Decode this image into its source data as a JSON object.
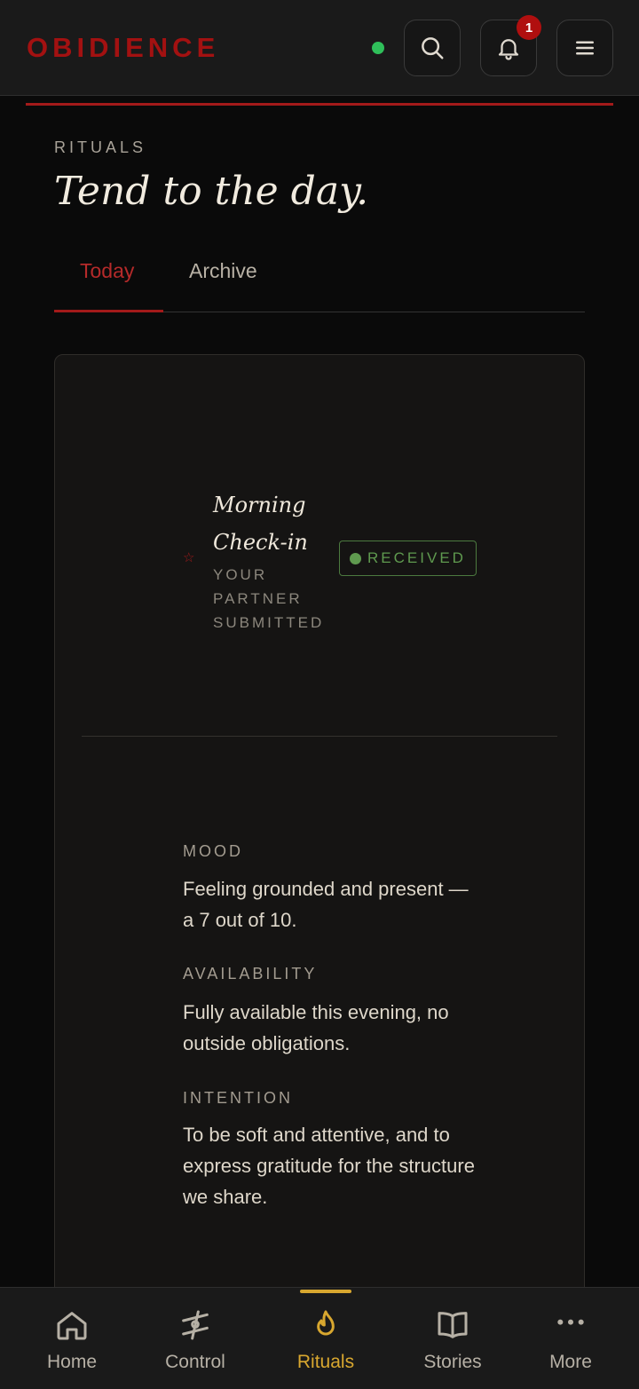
{
  "header": {
    "brand": "OBIDIENCE",
    "notification_count": "1",
    "icons": [
      "search-icon",
      "bell-icon",
      "menu-icon"
    ],
    "status_color": "#2fbf5a"
  },
  "page": {
    "eyebrow": "RITUALS",
    "title": "Tend to the day."
  },
  "tabs": [
    {
      "label": "Today",
      "active": true
    },
    {
      "label": "Archive",
      "active": false
    }
  ],
  "checkin": {
    "title": "Morning Check-in",
    "subtitle": "YOUR PARTNER SUBMITTED",
    "status": "RECEIVED",
    "fields": [
      {
        "label": "MOOD",
        "value": "Feeling grounded and present — a 7 out of 10."
      },
      {
        "label": "AVAILABILITY",
        "value": "Fully available this evening, no outside obligations."
      },
      {
        "label": "INTENTION",
        "value": "To be soft and attentive, and to express gratitude for the structure we share."
      }
    ]
  },
  "bottom_nav": [
    {
      "label": "Home",
      "icon": "home-icon"
    },
    {
      "label": "Control",
      "icon": "control-icon"
    },
    {
      "label": "Rituals",
      "icon": "flame-icon",
      "active": true
    },
    {
      "label": "Stories",
      "icon": "book-icon"
    },
    {
      "label": "More",
      "icon": "more-icon"
    }
  ],
  "colors": {
    "accent_red": "#a31a1a",
    "active_gold": "#d8a72f",
    "success_green": "#5f9a4f"
  }
}
